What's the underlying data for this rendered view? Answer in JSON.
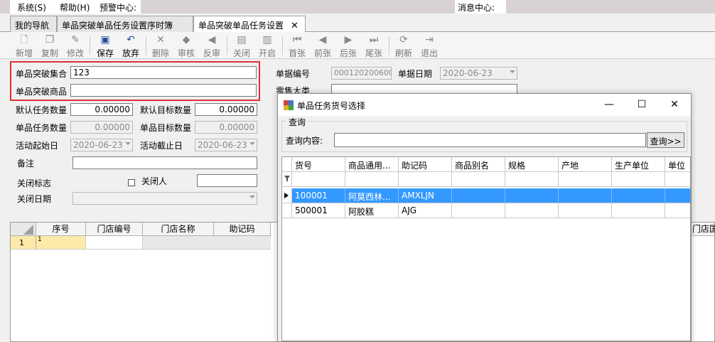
{
  "menubar": {
    "items": [
      "系统(S)",
      "帮助(H)",
      "预警中心:"
    ],
    "message_center": "消息中心:"
  },
  "tabs": [
    {
      "label": "我的导航"
    },
    {
      "label": "单品突破单品任务设置序时簿"
    },
    {
      "label": "单品突破单品任务设置",
      "active": true
    }
  ],
  "tab_close": "✕",
  "toolbar": {
    "items": [
      {
        "label": "新增",
        "icon": "new-icon"
      },
      {
        "label": "复制",
        "icon": "copy-icon"
      },
      {
        "label": "修改",
        "icon": "edit-icon"
      },
      {
        "label": "保存",
        "icon": "save-icon",
        "enabled": true
      },
      {
        "label": "放弃",
        "icon": "undo-icon",
        "enabled": true
      },
      {
        "label": "删除",
        "icon": "delete-icon"
      },
      {
        "label": "审核",
        "icon": "approve-icon"
      },
      {
        "label": "反审",
        "icon": "unapprove-icon"
      },
      {
        "label": "关闭",
        "icon": "close-doc-icon"
      },
      {
        "label": "开启",
        "icon": "open-doc-icon"
      },
      {
        "label": "首张",
        "icon": "first-icon"
      },
      {
        "label": "前张",
        "icon": "prev-icon"
      },
      {
        "label": "后张",
        "icon": "next-icon"
      },
      {
        "label": "尾张",
        "icon": "last-icon"
      },
      {
        "label": "刷新",
        "icon": "refresh-icon"
      },
      {
        "label": "退出",
        "icon": "exit-icon"
      }
    ]
  },
  "form": {
    "set_label": "单品突破集合",
    "set_value": "123",
    "product_label": "单品突破商品",
    "product_value": "",
    "doc_no_label": "单据编号",
    "doc_no_value": "0001202006000:",
    "doc_date_label": "单据日期",
    "doc_date_value": "2020-06-23",
    "category_label": "零售大类",
    "default_task_label": "默认任务数量",
    "default_task_value": "0.00000",
    "default_target_label": "默认目标数量",
    "default_target_value": "0.00000",
    "item_task_label": "单品任务数量",
    "item_task_value": "0.00000",
    "item_target_label": "单品目标数量",
    "item_target_value": "0.00000",
    "start_label": "活动起始日",
    "start_value": "2020-06-23",
    "end_label": "活动截止日",
    "end_value": "2020-06-23",
    "remark_label": "备注",
    "close_flag_label": "关闭标志",
    "closer_label": "关闭人",
    "close_date_label": "关闭日期"
  },
  "grid": {
    "headers": [
      "序号",
      "门店编号",
      "门店名称",
      "助记码",
      "门店国"
    ],
    "row_number": "1",
    "row_value": "1"
  },
  "dialog": {
    "title": "单品任务货号选择",
    "group_label": "查询",
    "query_label": "查询内容:",
    "query_value": "",
    "query_button": "查询>>",
    "columns": [
      "货号",
      "商品通用...",
      "助记码",
      "商品别名",
      "规格",
      "产地",
      "生产单位",
      "单位"
    ],
    "filter_icon": "filter-icon",
    "rows": [
      {
        "code": "100001",
        "name": "阿莫西林...",
        "mnemonic": "AMXLJN",
        "selected": true
      },
      {
        "code": "500001",
        "name": "阿胶糕",
        "mnemonic": "AJG",
        "selected": false
      }
    ]
  },
  "colors": {
    "highlight": "#e03030",
    "selection": "#3399ff",
    "toolbar_enabled_icon": "#1f4d9a"
  }
}
